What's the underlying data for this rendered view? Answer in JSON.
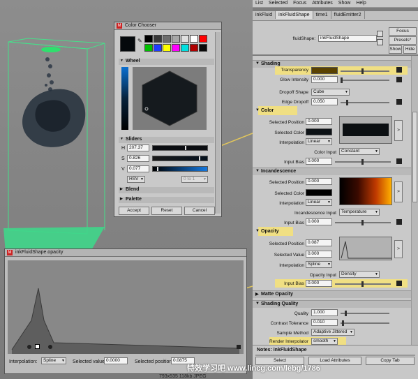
{
  "menubar": [
    "List",
    "Selected",
    "Focus",
    "Attributes",
    "Show",
    "Help"
  ],
  "tabs": [
    "inkFluid",
    "inkFluidShape",
    "time1",
    "fluidEmitter2"
  ],
  "header": {
    "shape_label": "fluidShape:",
    "shape_value": "inkFluidShape",
    "focus_label": "Focus",
    "presets_label": "Presets*",
    "show_label": "Show",
    "hide_label": "Hide"
  },
  "shading": {
    "title": "Shading",
    "transparency_label": "Transparency",
    "glow_label": "Glow Intensity",
    "glow_value": "0.000",
    "dropoff_label": "Dropoff Shape",
    "dropoff_value": "Cube",
    "edge_label": "Edge Dropoff",
    "edge_value": "0.050"
  },
  "color": {
    "title": "Color",
    "selpos_label": "Selected Position",
    "selpos_value": "0.000",
    "selcolor_label": "Selected Color",
    "interp_label": "Interpolation",
    "interp_value": "Linear",
    "input_label": "Color Input",
    "input_value": "Constant",
    "bias_label": "Input Bias",
    "bias_value": "0.000"
  },
  "incandescence": {
    "title": "Incandescence",
    "selpos_label": "Selected Position",
    "selpos_value": "0.000",
    "selcolor_label": "Selected Color",
    "interp_label": "Interpolation",
    "interp_value": "Linear",
    "input_label": "Incandescence Input",
    "input_value": "Temperature",
    "bias_label": "Input Bias",
    "bias_value": "0.000"
  },
  "opacity": {
    "title": "Opacity",
    "selpos_label": "Selected Position",
    "selpos_value": "0.087",
    "selval_label": "Selected Value",
    "selval_value": "0.000",
    "interp_label": "Interpolation",
    "interp_value": "Spline",
    "input_label": "Opacity Input",
    "input_value": "Density",
    "bias_label": "Input Bias",
    "bias_value": "0.000"
  },
  "matte": {
    "title": "Matte Opacity"
  },
  "shading_quality": {
    "title": "Shading Quality",
    "quality_label": "Quality",
    "quality_value": "1.000",
    "contrast_label": "Contrast Tolerance",
    "contrast_value": "0.010",
    "sample_label": "Sample Method",
    "sample_value": "Adaptive Jittered",
    "render_label": "Render Interpolator",
    "render_value": "smooth"
  },
  "notes_label": "Notes:  inkFluidShape",
  "bottom_buttons": [
    "Select",
    "Load Attributes",
    "Copy Tab"
  ],
  "chooser": {
    "title": "Color Chooser",
    "wheel_label": "Wheel",
    "sliders_label": "Sliders",
    "h_label": "H",
    "h_value": "207.37",
    "s_label": "S",
    "s_value": "0.826",
    "v_label": "V",
    "v_value": "0.077",
    "mode_value": "HSV",
    "range_value": "0 to 1",
    "blend_label": "Blend",
    "palette_label": "Palette",
    "accept": "Accept",
    "reset": "Reset",
    "cancel": "Cancel",
    "swatches": [
      "#000000",
      "#3a3a3a",
      "#6e6e6e",
      "#a8a8a8",
      "#e0e0e0",
      "#ffffff",
      "#ff0000",
      "#00c000",
      "#1e3cff",
      "#ffff00",
      "#ff00ff",
      "#00e0e0",
      "#b00000",
      "#0a0a0a"
    ]
  },
  "graph": {
    "title": "inkFluidShape.opacity",
    "interp_label": "Interpolation:",
    "interp_value": "Spline",
    "selval_label": "Selected value:",
    "selval_value": "0.0000",
    "selpos_label": "Selected position:",
    "selpos_value": "0.0875"
  },
  "watermark": "特效学习吧   www.lincg.com/lebg/1786",
  "status": "793x535 118kb JPEG"
}
